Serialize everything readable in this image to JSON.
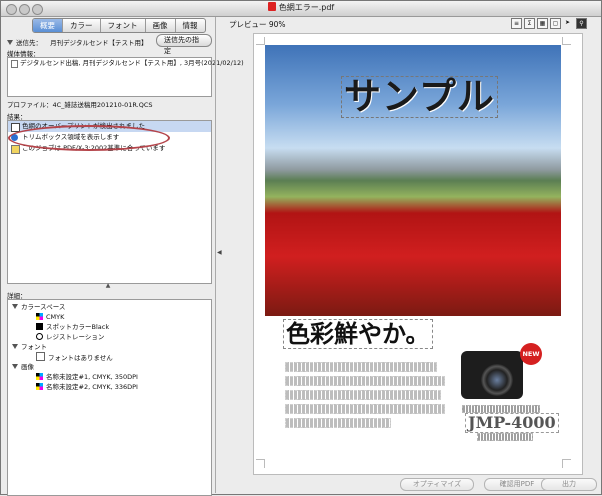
{
  "window": {
    "title": "色網エラー.pdf"
  },
  "tabs": [
    "概要",
    "カラー",
    "フォント",
    "画像",
    "情報"
  ],
  "destination": {
    "label": "送信先：",
    "value": "月刊デジタルセンド【テスト用】",
    "button": "送信先の指定"
  },
  "media_info": {
    "label": "媒体情報：",
    "value": "デジタルセンド出稿, 月刊デジタルセンド【テスト用】, 3月号(2021/02/12)"
  },
  "profile": {
    "label": "プロファイル：",
    "value": "4C_雑誌送稿用201210-01R.QCS"
  },
  "results": {
    "label": "結果：",
    "items": [
      {
        "icon": "warning-icon",
        "text": "色網のオーバープリントが検出されました"
      },
      {
        "icon": "info-icon",
        "text": "トリムボックス領域を表示します"
      },
      {
        "icon": "document-icon",
        "text": "このジョブは PDF/X-3:2002基準に合っています"
      }
    ]
  },
  "details": {
    "label": "詳細：",
    "groups": [
      {
        "name": "カラースペース",
        "items": [
          {
            "icon": "cmyk-icon",
            "text": "CMYK"
          },
          {
            "icon": "spot-color-icon",
            "text": "スポットカラーBlack"
          },
          {
            "icon": "registration-icon",
            "text": "レジストレーション"
          }
        ]
      },
      {
        "name": "フォント",
        "items": [
          {
            "icon": "font-icon",
            "text": "フォントはありません"
          }
        ]
      },
      {
        "name": "画像",
        "items": [
          {
            "icon": "image-icon",
            "text": "名称未設定#1, CMYK, 350DPI"
          },
          {
            "icon": "image-icon",
            "text": "名称未設定#2, CMYK, 336DPI"
          }
        ]
      }
    ]
  },
  "preview": {
    "label": "プレビュー 90%",
    "page": {
      "banner": "サンプル",
      "headline": "色彩鮮やか。",
      "badge": "NEW",
      "model": "JMP-4000"
    }
  },
  "bottom_buttons": [
    "オプティマイズ",
    "確認用PDF",
    "出力"
  ],
  "colors": {
    "accent": "#5a8fd6",
    "highlight": "#c7d8f2",
    "annotation": "#b4444a"
  }
}
